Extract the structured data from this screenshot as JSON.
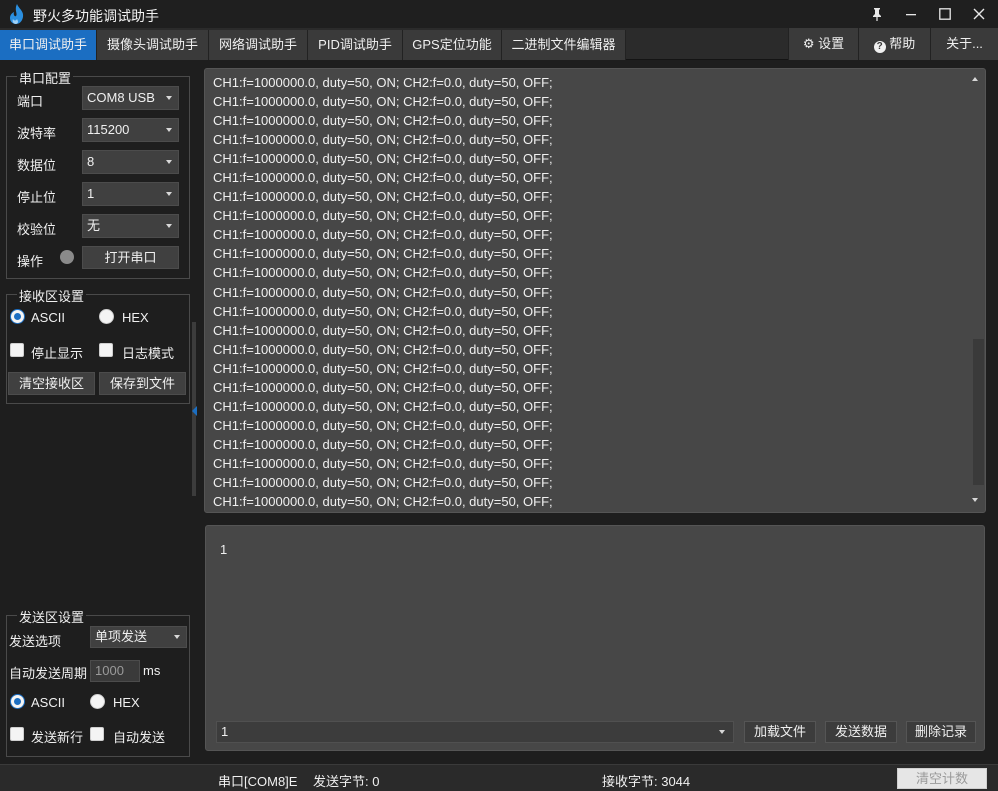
{
  "window": {
    "title": "野火多功能调试助手"
  },
  "tabs": [
    {
      "label": "串口调试助手",
      "active": true
    },
    {
      "label": "摄像头调试助手",
      "active": false
    },
    {
      "label": "网络调试助手",
      "active": false
    },
    {
      "label": "PID调试助手",
      "active": false
    },
    {
      "label": "GPS定位功能",
      "active": false
    },
    {
      "label": "二进制文件编辑器",
      "active": false
    }
  ],
  "right_buttons": {
    "settings": "设置",
    "help": "帮助",
    "about": "关于..."
  },
  "serial_config": {
    "title": "串口配置",
    "port_label": "端口",
    "port_value": "COM8 USB",
    "baud_label": "波特率",
    "baud_value": "115200",
    "databits_label": "数据位",
    "databits_value": "8",
    "stopbits_label": "停止位",
    "stopbits_value": "1",
    "parity_label": "校验位",
    "parity_value": "无",
    "operation_label": "操作",
    "open_button": "打开串口"
  },
  "receive_settings": {
    "title": "接收区设置",
    "ascii_label": "ASCII",
    "hex_label": "HEX",
    "ascii_selected": true,
    "stop_display_label": "停止显示",
    "log_mode_label": "日志模式",
    "clear_button": "清空接收区",
    "save_button": "保存到文件"
  },
  "send_settings": {
    "title": "发送区设置",
    "option_label": "发送选项",
    "option_value": "单项发送",
    "period_label": "自动发送周期",
    "period_value": "1000",
    "period_unit": "ms",
    "ascii_label": "ASCII",
    "hex_label": "HEX",
    "ascii_selected": true,
    "newline_label": "发送新行",
    "auto_send_label": "自动发送"
  },
  "receive_area": {
    "lines": [
      "CH1:f=1000000.0, duty=50, ON; CH2:f=0.0, duty=50, OFF;",
      "CH1:f=1000000.0, duty=50, ON; CH2:f=0.0, duty=50, OFF;",
      "CH1:f=1000000.0, duty=50, ON; CH2:f=0.0, duty=50, OFF;",
      "CH1:f=1000000.0, duty=50, ON; CH2:f=0.0, duty=50, OFF;",
      "CH1:f=1000000.0, duty=50, ON; CH2:f=0.0, duty=50, OFF;",
      "CH1:f=1000000.0, duty=50, ON; CH2:f=0.0, duty=50, OFF;",
      "CH1:f=1000000.0, duty=50, ON; CH2:f=0.0, duty=50, OFF;",
      "CH1:f=1000000.0, duty=50, ON; CH2:f=0.0, duty=50, OFF;",
      "CH1:f=1000000.0, duty=50, ON; CH2:f=0.0, duty=50, OFF;",
      "CH1:f=1000000.0, duty=50, ON; CH2:f=0.0, duty=50, OFF;",
      "CH1:f=1000000.0, duty=50, ON; CH2:f=0.0, duty=50, OFF;",
      "CH1:f=1000000.0, duty=50, ON; CH2:f=0.0, duty=50, OFF;",
      "CH1:f=1000000.0, duty=50, ON; CH2:f=0.0, duty=50, OFF;",
      "CH1:f=1000000.0, duty=50, ON; CH2:f=0.0, duty=50, OFF;",
      "CH1:f=1000000.0, duty=50, ON; CH2:f=0.0, duty=50, OFF;",
      "CH1:f=1000000.0, duty=50, ON; CH2:f=0.0, duty=50, OFF;",
      "CH1:f=1000000.0, duty=50, ON; CH2:f=0.0, duty=50, OFF;",
      "CH1:f=1000000.0, duty=50, ON; CH2:f=0.0, duty=50, OFF;",
      "CH1:f=1000000.0, duty=50, ON; CH2:f=0.0, duty=50, OFF;",
      "CH1:f=1000000.0, duty=50, ON; CH2:f=0.0, duty=50, OFF;",
      "CH1:f=1000000.0, duty=50, ON; CH2:f=0.0, duty=50, OFF;",
      "CH1:f=1000000.0, duty=50, ON; CH2:f=0.0, duty=50, OFF;",
      "CH1:f=1000000.0, duty=50, ON; CH2:f=0.0, duty=50, OFF;"
    ]
  },
  "send_area": {
    "text": "1",
    "history_value": "1",
    "load_file_button": "加载文件",
    "send_button": "发送数据",
    "delete_button": "删除记录"
  },
  "status": {
    "port": "串口[COM8]E",
    "sent": "发送字节: 0",
    "received": "接收字节: 3044",
    "clear_count_button": "清空计数"
  },
  "colors": {
    "accent": "#1b6ec2",
    "background": "#1e1e1e",
    "panel": "#474747",
    "led_off": "#8a8a8a"
  },
  "icons": {
    "app": "flame-icon",
    "pin": "pin-icon",
    "minimize": "minimize-icon",
    "maximize": "maximize-icon",
    "close": "close-icon",
    "settings": "gear-icon",
    "help": "question-icon"
  }
}
